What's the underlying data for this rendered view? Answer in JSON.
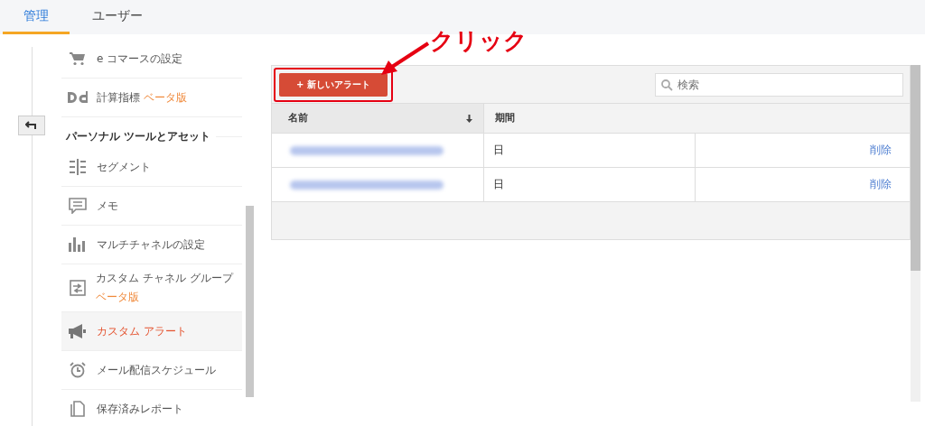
{
  "tabs": [
    {
      "label": "管理",
      "selected": true
    },
    {
      "label": "ユーザー",
      "selected": false
    }
  ],
  "nav": [
    {
      "kind": "item",
      "label": "e コマースの設定",
      "selected": false
    },
    {
      "kind": "item",
      "label": "計算指標",
      "badge": "ベータ版",
      "selected": false
    },
    {
      "kind": "header",
      "label": "パーソナル ツールとアセット"
    },
    {
      "kind": "item",
      "label": "セグメント",
      "selected": false
    },
    {
      "kind": "item",
      "label": "メモ",
      "selected": false
    },
    {
      "kind": "item",
      "label": "マルチチャネルの設定",
      "selected": false
    },
    {
      "kind": "item",
      "label": "カスタム チャネル グループ",
      "badge": "ベータ版",
      "selected": false
    },
    {
      "kind": "item",
      "label": "カスタム アラート",
      "selected": true
    },
    {
      "kind": "item",
      "label": "メール配信スケジュール",
      "selected": false
    },
    {
      "kind": "item",
      "label": "保存済みレポート",
      "selected": false
    }
  ],
  "annotation": {
    "label": "クリック"
  },
  "new_button": {
    "label": "+ 新しいアラート"
  },
  "search": {
    "placeholder": "検索"
  },
  "table": {
    "columns": [
      "名前",
      "期間"
    ],
    "rows": [
      {
        "period": "日",
        "action": "削除"
      },
      {
        "period": "日",
        "action": "削除"
      }
    ]
  }
}
